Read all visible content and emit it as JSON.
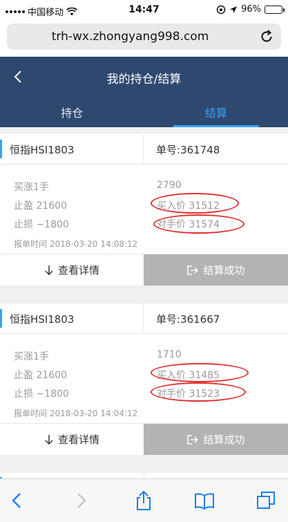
{
  "status_bar": {
    "carrier": "中国移动",
    "time": "14:47",
    "battery_percent": "96%",
    "battery_level": 0.96
  },
  "browser": {
    "url": "trh-wx.zhongyang998.com"
  },
  "header": {
    "title": "我的持仓/结算",
    "tabs": [
      {
        "label": "持仓",
        "active": false
      },
      {
        "label": "结算",
        "active": true
      }
    ]
  },
  "orders": [
    {
      "product": "恒指HSI1803",
      "order_no": "单号:361748",
      "direction": "买涨1手",
      "take_profit": "止盈  21600",
      "stop_loss": "止损  −1800",
      "amount": "2790",
      "buy_price": "买入价  31512",
      "counter_price": "对手价  31574",
      "order_time": "报单时间  2018-03-20 14:08:12",
      "detail_label": "查看详情",
      "status_label": "结算成功"
    },
    {
      "product": "恒指HSI1803",
      "order_no": "单号:361667",
      "direction": "买涨1手",
      "take_profit": "止盈  21600",
      "stop_loss": "止损  −1800",
      "amount": "1710",
      "buy_price": "买入价  31485",
      "counter_price": "对手价  31523",
      "order_time": "报单时间  2018-03-20 14:04:12",
      "detail_label": "查看详情",
      "status_label": "结算成功"
    }
  ],
  "colors": {
    "header_bg": "#2e4870",
    "accent": "#3aa0f0",
    "annotation_red": "#e03030",
    "done_button_bg": "#b3b3b3"
  }
}
